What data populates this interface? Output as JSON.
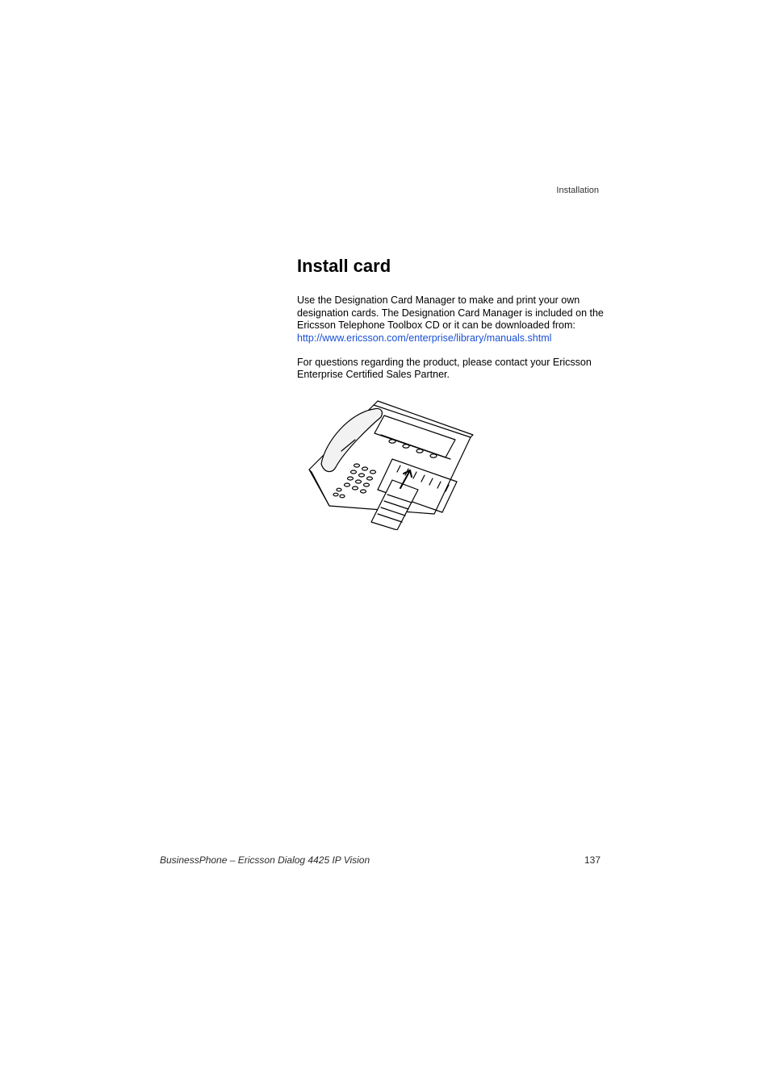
{
  "header": {
    "section": "Installation"
  },
  "content": {
    "heading": "Install card",
    "para1a": "Use the Designation Card Manager to make and print your own designation cards. The Designation Card Manager is included on the Ericsson Telephone Toolbox CD or it can be downloaded from: ",
    "link_text": "http://www.ericsson.com/enterprise/library/manuals.shtml",
    "para2": "For questions regarding the product, please contact your Ericsson Enterprise Certified Sales Partner."
  },
  "footer": {
    "title": "BusinessPhone – Ericsson Dialog 4425 IP Vision",
    "page": "137"
  }
}
